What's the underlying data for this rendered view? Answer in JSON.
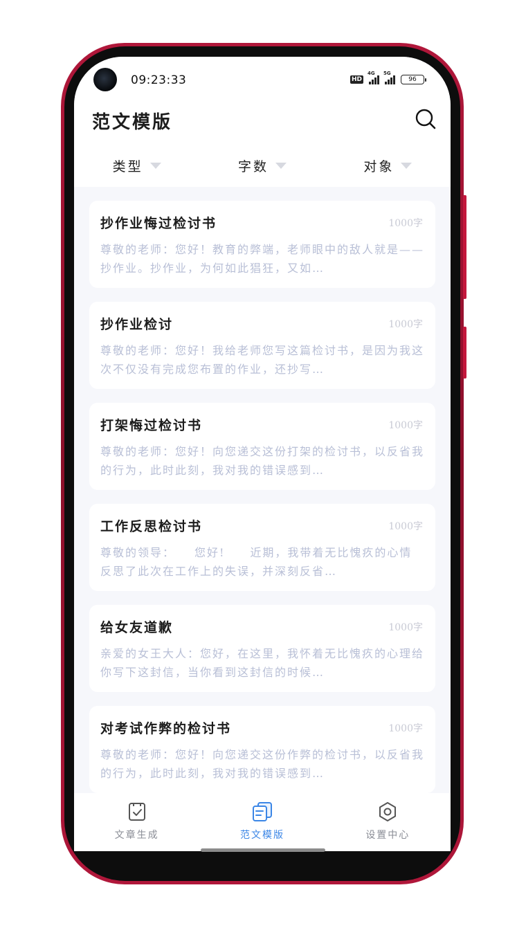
{
  "status_bar": {
    "time": "09:23:33",
    "hd_badge": "HD",
    "net_1": "4G",
    "net_2": "5G",
    "battery": "96"
  },
  "header": {
    "title": "范文模版",
    "search_icon": "search-icon"
  },
  "filters": [
    {
      "label": "类型"
    },
    {
      "label": "字数"
    },
    {
      "label": "对象"
    }
  ],
  "articles": [
    {
      "title": "抄作业悔过检讨书",
      "count": "1000字",
      "preview": "尊敬的老师：您好！教育的弊端，老师眼中的敌人就是——抄作业。抄作业，为何如此猖狂，又如…"
    },
    {
      "title": "抄作业检讨",
      "count": "1000字",
      "preview": "尊敬的老师：您好！我给老师您写这篇检讨书，是因为我这次不仅没有完成您布置的作业，还抄写…"
    },
    {
      "title": "打架悔过检讨书",
      "count": "1000字",
      "preview": "尊敬的老师：您好！向您递交这份打架的检讨书，以反省我的行为，此时此刻，我对我的错误感到…"
    },
    {
      "title": "工作反思检讨书",
      "count": "1000字",
      "preview": "尊敬的领导：　　您好!　　近期，我带着无比愧疚的心情反思了此次在工作上的失误，并深刻反省…"
    },
    {
      "title": "给女友道歉",
      "count": "1000字",
      "preview": "亲爱的女王大人：您好，在这里，我怀着无比愧疚的心理给你写下这封信，当你看到这封信的时候…"
    },
    {
      "title": "对考试作弊的检讨书",
      "count": "1000字",
      "preview": "尊敬的老师：您好！向您递交这份作弊的检讨书，以反省我的行为，此时此刻，我对我的错误感到…"
    }
  ],
  "bottom_nav": [
    {
      "label": "文章生成",
      "icon": "document-check-icon",
      "active": false
    },
    {
      "label": "范文模版",
      "icon": "templates-icon",
      "active": true
    },
    {
      "label": "设置中心",
      "icon": "settings-hexagon-icon",
      "active": false
    }
  ],
  "colors": {
    "frame": "#b0173a",
    "accent": "#3b86e6",
    "preview_text": "#b8bfd6",
    "background": "#f6f7fb"
  }
}
